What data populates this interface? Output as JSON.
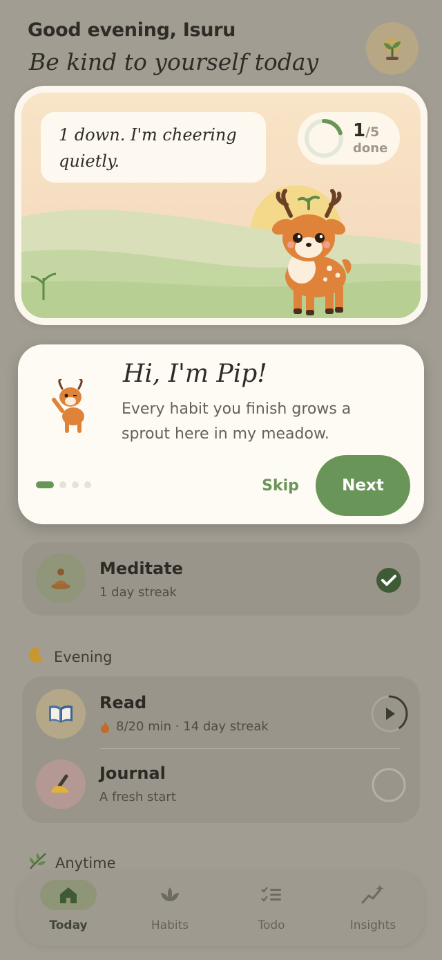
{
  "header": {
    "greeting": "Good evening, Isuru",
    "subtitle": "Be kind to yourself today",
    "avatar_icon": "sprout-icon"
  },
  "hero": {
    "message_line1": "1 down. I'm cheering",
    "message_line2": "quietly.",
    "progress": {
      "done": 1,
      "done_text": "1",
      "total_text": "/5",
      "label": "done",
      "fraction": 0.2
    }
  },
  "onboarding": {
    "title": "Hi, I'm Pip!",
    "body": "Every habit you finish grows a sprout here in my meadow.",
    "step": 1,
    "steps": 4,
    "skip_label": "Skip",
    "next_label": "Next"
  },
  "habits": {
    "meditate": {
      "name": "Meditate",
      "meta": "1 day streak",
      "icon": "meditation-icon",
      "completed": true
    },
    "evening_label": "Evening",
    "read": {
      "name": "Read",
      "meta": "8/20 min · 14 day streak",
      "icon": "book-icon",
      "progress": 0.4
    },
    "journal": {
      "name": "Journal",
      "meta": "A fresh start",
      "icon": "writing-hand-icon",
      "completed": false
    },
    "anytime_label": "Anytime"
  },
  "nav": {
    "items": [
      {
        "label": "Today",
        "icon": "home-icon",
        "active": true
      },
      {
        "label": "Habits",
        "icon": "lotus-icon",
        "active": false
      },
      {
        "label": "Todo",
        "icon": "checklist-icon",
        "active": false
      },
      {
        "label": "Insights",
        "icon": "sparkle-chart-icon",
        "active": false
      }
    ]
  },
  "colors": {
    "accent": "#6a9558",
    "card": "#fdfbf3",
    "overlay": "#a29d93"
  }
}
